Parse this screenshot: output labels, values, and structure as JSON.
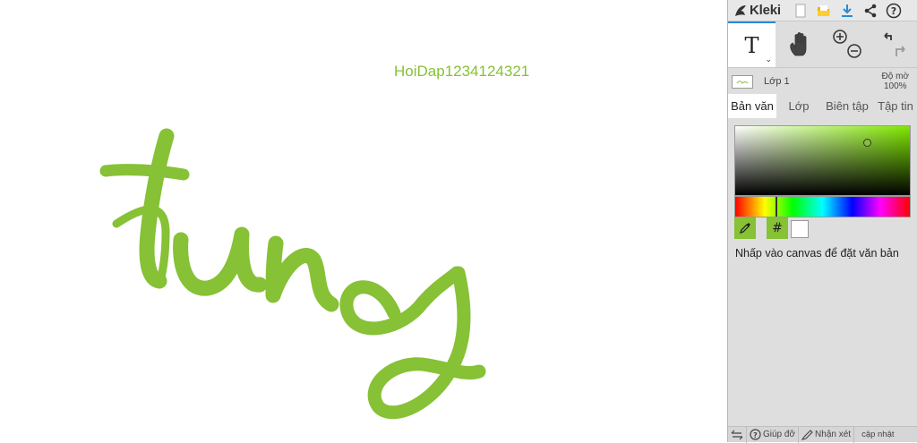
{
  "canvas": {
    "label": "HoiDap1234124321",
    "text_color": "#86c136",
    "artwork_text": "trung"
  },
  "app": {
    "name": "Kleki",
    "accent": "#2a8ad4"
  },
  "topbar_icons": [
    "logo-icon",
    "new-icon",
    "open-icon",
    "download-icon",
    "share-icon",
    "help-icon"
  ],
  "tools": {
    "text_tool_label": "T",
    "text_tool_caret": "⌄"
  },
  "layer": {
    "name": "Lớp 1",
    "opacity_label": "Độ mờ",
    "opacity_value": "100%"
  },
  "tabs": [
    {
      "label": "Bản văn",
      "active": true
    },
    {
      "label": "Lớp",
      "active": false
    },
    {
      "label": "Biên tập",
      "active": false
    },
    {
      "label": "Tập tin",
      "active": false
    }
  ],
  "color": {
    "current": "#86c136",
    "secondary": "#ffffff",
    "hex_label": "#"
  },
  "hint": "Nhấp vào canvas để đặt văn bản",
  "bottom": {
    "help_label": "Giúp đỡ",
    "feedback_label": "Nhận xét",
    "update_label": "cập nhật"
  }
}
